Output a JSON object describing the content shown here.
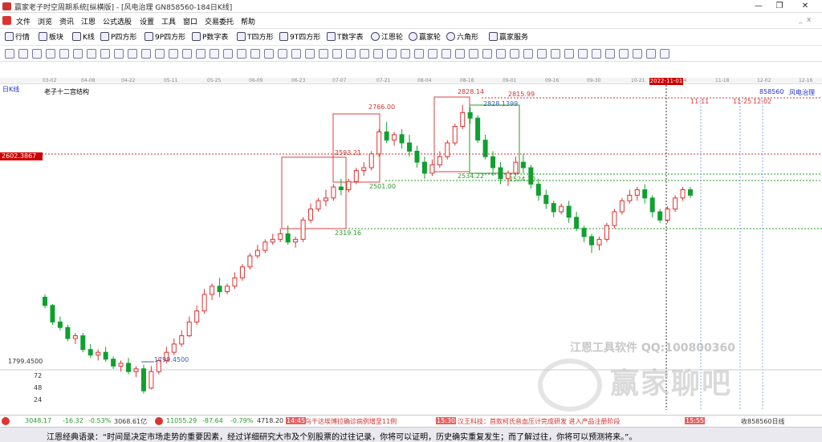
{
  "window": {
    "title": "赢家老子时空周期系统[纵横版] - [风电治理  GN858560-184日K线]",
    "min": "—",
    "max": "❐",
    "close": "✕"
  },
  "menu": [
    "文件",
    "浏览",
    "资讯",
    "江恩",
    "公式选股",
    "设置",
    "工具",
    "窗口",
    "交易委托",
    "帮助"
  ],
  "toolbar1": [
    "行情",
    "板块",
    "K线",
    "P四方形",
    "9P四方形",
    "P数字表",
    "T四方形",
    "9T四方形",
    "T数字表",
    "江恩轮",
    "赢家轮",
    "六角形",
    "赢家服务"
  ],
  "date_axis": [
    "03-02",
    "04-08",
    "04-22",
    "05-11",
    "05-25",
    "06-09",
    "06-23",
    "07-07",
    "07-21",
    "08-04",
    "08-18",
    "09-01",
    "09-16",
    "09-30",
    "10-21",
    "11-04",
    "11-18",
    "12-02",
    "12-16"
  ],
  "day_badge": "2022-11-01",
  "period_label": "日K线",
  "indicator_label": "老子十二宫结构",
  "code_label": "858560",
  "name_label": "风电治理",
  "future_marks": [
    "11-11",
    "11-25",
    "12-02"
  ],
  "price_badge": "2602.3867",
  "axis_labels": [
    "1799.4500",
    "72",
    "48",
    "24"
  ],
  "level_labels": {
    "high_2766": "2766.00",
    "high_2828": "2828.14",
    "level_2815": "2815.99",
    "level_2828b": "2828.1399",
    "level_2593": "2593.21",
    "level_2534": "2534.22",
    "level_2524": "2524.20",
    "level_2501": "2501.00",
    "level_2319": "2319.16",
    "low_1799": "1799.4500"
  },
  "watermark": {
    "line1": "江恩工具软件  QQ:100800360",
    "line2": "赢家聊吧"
  },
  "status": {
    "sh_idx": "3048.17",
    "sh_chg": "-16.32",
    "sh_pct": "-0.53%",
    "sh_vol": "3068.61亿",
    "sz_idx": "11055.29",
    "sz_chg": "-87.64",
    "sz_pct": "-0.79%",
    "sz_vol": "4718.20",
    "news1_time": "14:45",
    "news1": "乌干达埃博拉确诊病例增至11例",
    "news2_time": "15:30",
    "news2": "汉王科技：首款柯氏音血压计完成研发 进入产品注册阶段",
    "news3_time": "15:55",
    "right": "收858560日线"
  },
  "quote": "江恩经典语录：“时间是决定市场走势的重要因素，经过详细研究大市及个别股票的过往记录，你将可以证明，历史确实重复发生；而了解过往，你将可以预测将来。”。",
  "colors": {
    "up": "#e03030",
    "down": "#10a030",
    "box": "#d84040",
    "green_line": "#2a9a2a",
    "blue": "#3060c0",
    "dash_red": "#d03030"
  },
  "chart_data": {
    "type": "candlestick",
    "title": "老子十二宫结构",
    "ylim": [
      1750,
      2900
    ],
    "candles": [
      [
        2130,
        2140,
        2100,
        2090
      ],
      [
        2100,
        2105,
        2040,
        2030
      ],
      [
        2040,
        2060,
        2020,
        2010
      ],
      [
        2020,
        2030,
        1980,
        1970
      ],
      [
        1980,
        2000,
        1990,
        1960
      ],
      [
        1990,
        2000,
        1940,
        1930
      ],
      [
        1940,
        1960,
        1920,
        1910
      ],
      [
        1920,
        1940,
        1930,
        1900
      ],
      [
        1930,
        1950,
        1905,
        1895
      ],
      [
        1905,
        1915,
        1880,
        1870
      ],
      [
        1880,
        1900,
        1890,
        1860
      ],
      [
        1890,
        1910,
        1860,
        1850
      ],
      [
        1860,
        1880,
        1870,
        1840
      ],
      [
        1870,
        1885,
        1790,
        1780
      ],
      [
        1800,
        1880,
        1860,
        1795
      ],
      [
        1860,
        1910,
        1900,
        1850
      ],
      [
        1900,
        1950,
        1930,
        1890
      ],
      [
        1930,
        1980,
        1960,
        1920
      ],
      [
        1960,
        2010,
        1990,
        1950
      ],
      [
        1990,
        2060,
        2040,
        1985
      ],
      [
        2040,
        2100,
        2080,
        2030
      ],
      [
        2080,
        2160,
        2140,
        2070
      ],
      [
        2140,
        2180,
        2170,
        2120
      ],
      [
        2170,
        2200,
        2150,
        2130
      ],
      [
        2150,
        2180,
        2170,
        2140
      ],
      [
        2170,
        2220,
        2200,
        2160
      ],
      [
        2200,
        2250,
        2240,
        2190
      ],
      [
        2240,
        2290,
        2280,
        2230
      ],
      [
        2280,
        2320,
        2300,
        2270
      ],
      [
        2300,
        2340,
        2330,
        2290
      ],
      [
        2330,
        2360,
        2340,
        2320
      ],
      [
        2340,
        2380,
        2360,
        2330
      ],
      [
        2360,
        2390,
        2330,
        2320
      ],
      [
        2330,
        2350,
        2340,
        2310
      ],
      [
        2340,
        2420,
        2410,
        2330
      ],
      [
        2410,
        2470,
        2450,
        2400
      ],
      [
        2450,
        2490,
        2480,
        2440
      ],
      [
        2480,
        2520,
        2490,
        2460
      ],
      [
        2490,
        2540,
        2530,
        2480
      ],
      [
        2530,
        2560,
        2520,
        2500
      ],
      [
        2520,
        2560,
        2550,
        2510
      ],
      [
        2550,
        2600,
        2590,
        2540
      ],
      [
        2590,
        2620,
        2600,
        2570
      ],
      [
        2600,
        2660,
        2650,
        2590
      ],
      [
        2650,
        2740,
        2730,
        2640
      ],
      [
        2730,
        2766,
        2700,
        2690
      ],
      [
        2700,
        2730,
        2720,
        2680
      ],
      [
        2720,
        2740,
        2690,
        2670
      ],
      [
        2690,
        2720,
        2660,
        2640
      ],
      [
        2660,
        2680,
        2620,
        2600
      ],
      [
        2620,
        2640,
        2580,
        2560
      ],
      [
        2580,
        2630,
        2610,
        2570
      ],
      [
        2610,
        2660,
        2640,
        2600
      ],
      [
        2640,
        2700,
        2690,
        2630
      ],
      [
        2690,
        2760,
        2750,
        2680
      ],
      [
        2750,
        2828,
        2800,
        2740
      ],
      [
        2800,
        2820,
        2780,
        2760
      ],
      [
        2780,
        2790,
        2700,
        2690
      ],
      [
        2700,
        2720,
        2640,
        2630
      ],
      [
        2640,
        2660,
        2600,
        2570
      ],
      [
        2600,
        2620,
        2560,
        2540
      ],
      [
        2560,
        2590,
        2580,
        2534
      ],
      [
        2580,
        2640,
        2620,
        2570
      ],
      [
        2620,
        2650,
        2600,
        2580
      ],
      [
        2600,
        2610,
        2540,
        2524
      ],
      [
        2540,
        2560,
        2500,
        2480
      ],
      [
        2500,
        2520,
        2470,
        2450
      ],
      [
        2470,
        2480,
        2440,
        2420
      ],
      [
        2440,
        2470,
        2460,
        2430
      ],
      [
        2460,
        2480,
        2420,
        2400
      ],
      [
        2420,
        2440,
        2380,
        2370
      ],
      [
        2380,
        2390,
        2350,
        2330
      ],
      [
        2350,
        2360,
        2320,
        2290
      ],
      [
        2320,
        2350,
        2340,
        2300
      ],
      [
        2340,
        2400,
        2390,
        2330
      ],
      [
        2390,
        2450,
        2440,
        2380
      ],
      [
        2440,
        2490,
        2480,
        2430
      ],
      [
        2480,
        2520,
        2500,
        2470
      ],
      [
        2500,
        2530,
        2520,
        2480
      ],
      [
        2520,
        2540,
        2490,
        2470
      ],
      [
        2490,
        2500,
        2440,
        2420
      ],
      [
        2440,
        2450,
        2410,
        2400
      ],
      [
        2410,
        2460,
        2450,
        2400
      ],
      [
        2450,
        2500,
        2490,
        2440
      ],
      [
        2490,
        2530,
        2520,
        2480
      ],
      [
        2520,
        2530,
        2500,
        2490
      ]
    ]
  }
}
